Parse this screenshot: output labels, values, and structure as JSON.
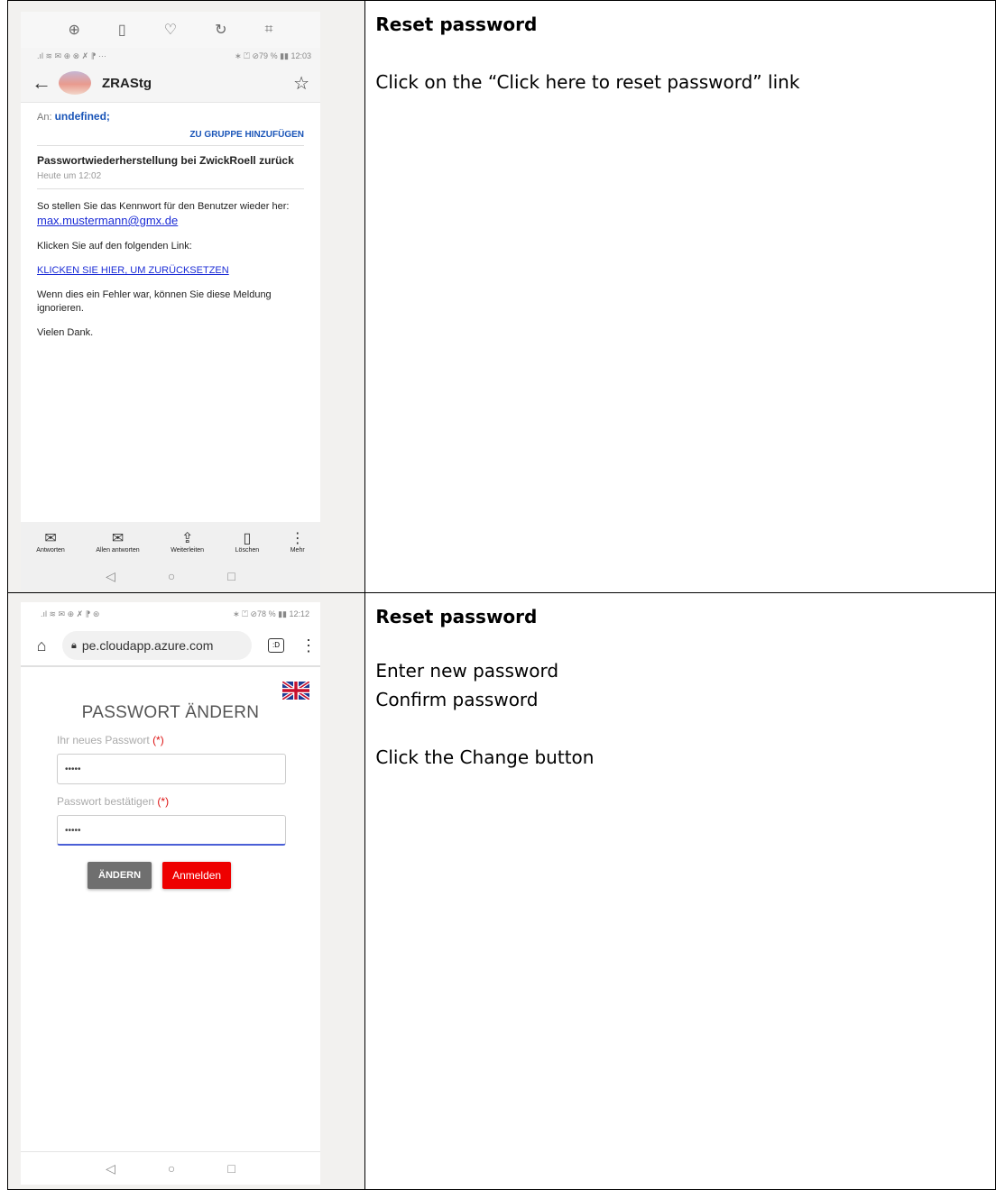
{
  "rows": [
    {
      "title": "Reset password",
      "lines": [
        "Click on the “Click here to reset password” link"
      ],
      "phone": {
        "viewer_icons": [
          "zoom-icon",
          "trash-icon",
          "heart-icon",
          "rotate-icon",
          "crop-icon"
        ],
        "status_left": ".ıl ≋ ✉ ⊕ ⊗ ✗ ⁋ ···",
        "status_right": "∗ ⏍ ⊘79 % ▮▮ 12:03",
        "sender": "ZRAStg",
        "to_label": "An:",
        "to_value": "undefined;",
        "add_group": "ZU GRUPPE HINZUFÜGEN",
        "subject": "Passwortwiederherstellung bei ZwickRoell zurück",
        "date": "Heute um 12:02",
        "para1": "So stellen Sie das Kennwort für den Benutzer wieder her:",
        "email": "max.mustermann@gmx.de",
        "para2": "Klicken Sie auf den folgenden Link:",
        "link": "KLICKEN SIE HIER, UM ZURÜCKSETZEN",
        "para3": "Wenn dies ein Fehler war, können Sie diese Meldung ignorieren.",
        "para4": "Vielen Dank.",
        "toolbar": [
          "Antworten",
          "Allen antworten",
          "Weiterleiten",
          "Löschen",
          "Mehr"
        ]
      }
    },
    {
      "title": "Reset password",
      "lines": [
        "Enter new password",
        "Confirm password",
        "",
        "Click the Change button"
      ],
      "phone": {
        "status_left": ".ıl ≋ ✉ ⊕ ✗ ⁋ ⊛",
        "status_right": "∗ ⏍ ⊘78 % ▮▮ 12:12",
        "url": "pe.cloudapp.azure.com",
        "heading": "PASSWORT ÄNDERN",
        "new_pw_label": "Ihr neues Passwort",
        "confirm_label": "Passwort bestätigen",
        "required": "(*)",
        "new_pw_value": "•••••",
        "confirm_value": "•••••",
        "change_btn": "ÄNDERN",
        "login_btn": "Anmelden"
      }
    }
  ]
}
